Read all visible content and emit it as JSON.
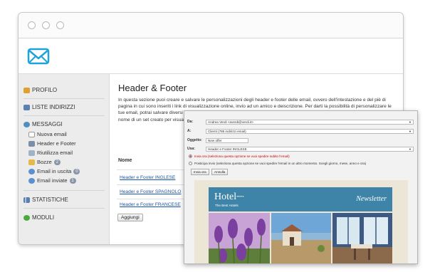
{
  "sidebar": {
    "items": [
      {
        "label": "Profilo",
        "icon": "lock-icon",
        "color": "#e0a030"
      },
      {
        "label": "Liste indirizzi",
        "icon": "list-icon",
        "color": "#5a7fb0"
      },
      {
        "label": "Messaggi",
        "icon": "messages-icon",
        "color": "#4f8fc0"
      },
      {
        "label": "Statistiche",
        "icon": "chart-icon",
        "color": "#5a7fb0"
      },
      {
        "label": "Moduli",
        "icon": "module-icon",
        "color": "#4caa3c"
      }
    ],
    "messages_sub": [
      {
        "label": "Nuova email",
        "icon": "new-email-icon"
      },
      {
        "label": "Header e Footer",
        "icon": "header-footer-icon"
      },
      {
        "label": "Riutilizza email",
        "icon": "reuse-icon"
      },
      {
        "label": "Bozze",
        "icon": "drafts-icon",
        "badge": "2"
      },
      {
        "label": "Email in uscita",
        "icon": "outbox-icon",
        "badge": "0"
      },
      {
        "label": "Email inviate",
        "icon": "sent-icon",
        "badge": "1"
      }
    ]
  },
  "main": {
    "title": "Header & Footer",
    "description": "In questa sezione puoi creare e salvare le personalizzazioni degli header e footer delle email, ovvero dell'intestazione e del piè di pagina in cui sono inseriti i link di visualizzazione online, invio ad un amico e deiscrizione. Per darti la possibilità di personalizzare le tue email, potrai salvare diversi stili di personalizzazione (set) da utilizzare al momento dell'invio della tua comunicazione. Clicca sul nome di un set creato per visualizzare le modifiche che hai apportato, oppure clicca sul tasto \"AGGIUNGI\" per crearne uno nuovo.",
    "column_header": "Nome",
    "rows": [
      "Header e Footer INGLESE",
      "Header e Footer SPAGNOLO",
      "Header e Footer FRANCESE"
    ],
    "add_button": "Aggiungi"
  },
  "compose": {
    "from_label": "Da:",
    "from_value": "Andrea Verdi <averdi@verdi.it>",
    "to_label": "A:",
    "to_value": "Clienti (786 indirizzi email)",
    "subject_label": "Oggetto:",
    "subject_value": "New offer",
    "use_label": "Usa:",
    "use_value": "Header e Footer INGLESE",
    "send_now_option": "Invia ora (seleziona questa opzione se vuoi spedire subito l'email)",
    "postpone_option": "Posticipa invio (seleziona questa opzione se vuoi spedire l'email in un altro momento. Scegli giorno, mese, anno e ora)",
    "send_button": "Invia ora",
    "cancel_button": "Annulla"
  },
  "newsletter": {
    "brand": "Hotel",
    "stars": "•••••",
    "tagline": "The Best Hotels",
    "title": "Newsletter",
    "header_color": "#3d84a8"
  }
}
